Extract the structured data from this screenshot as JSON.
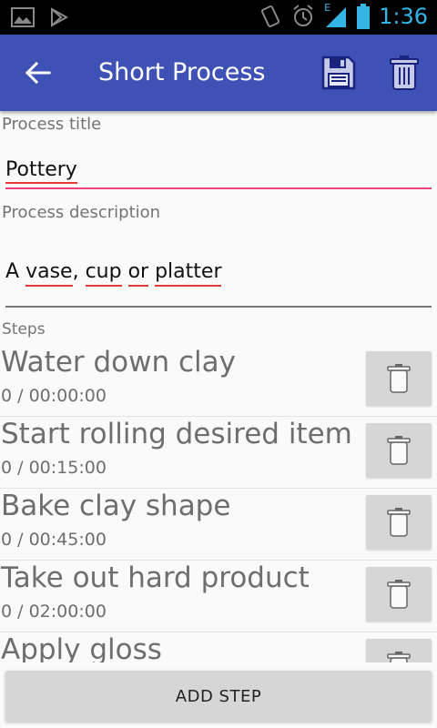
{
  "status_bar": {
    "time": "1:36",
    "icons": [
      "image-icon",
      "play-store-icon",
      "vibrate-icon",
      "alarm-icon",
      "signal-icon",
      "battery-icon"
    ],
    "network_label": "E"
  },
  "app_bar": {
    "title": "Short Process",
    "color": "#3f51b5"
  },
  "form": {
    "title_label": "Process title",
    "title_value": "Pottery",
    "description_label": "Process description",
    "description_words": [
      "A",
      "vase",
      ",",
      "cup",
      "or",
      "platter"
    ],
    "steps_label": "Steps"
  },
  "steps": [
    {
      "name": "Water down clay",
      "time": "0 / 00:00:00"
    },
    {
      "name": "Start rolling desired item",
      "time": "0 / 00:15:00"
    },
    {
      "name": "Bake clay shape",
      "time": "0 / 00:45:00"
    },
    {
      "name": "Take out hard product",
      "time": "0 / 02:00:00"
    },
    {
      "name": "Apply gloss",
      "time": ""
    }
  ],
  "actions": {
    "add_step_label": "ADD STEP"
  },
  "colors": {
    "accent": "#ec407a",
    "spellcheck": "#e53935",
    "status_icons": "#33b5e5"
  }
}
